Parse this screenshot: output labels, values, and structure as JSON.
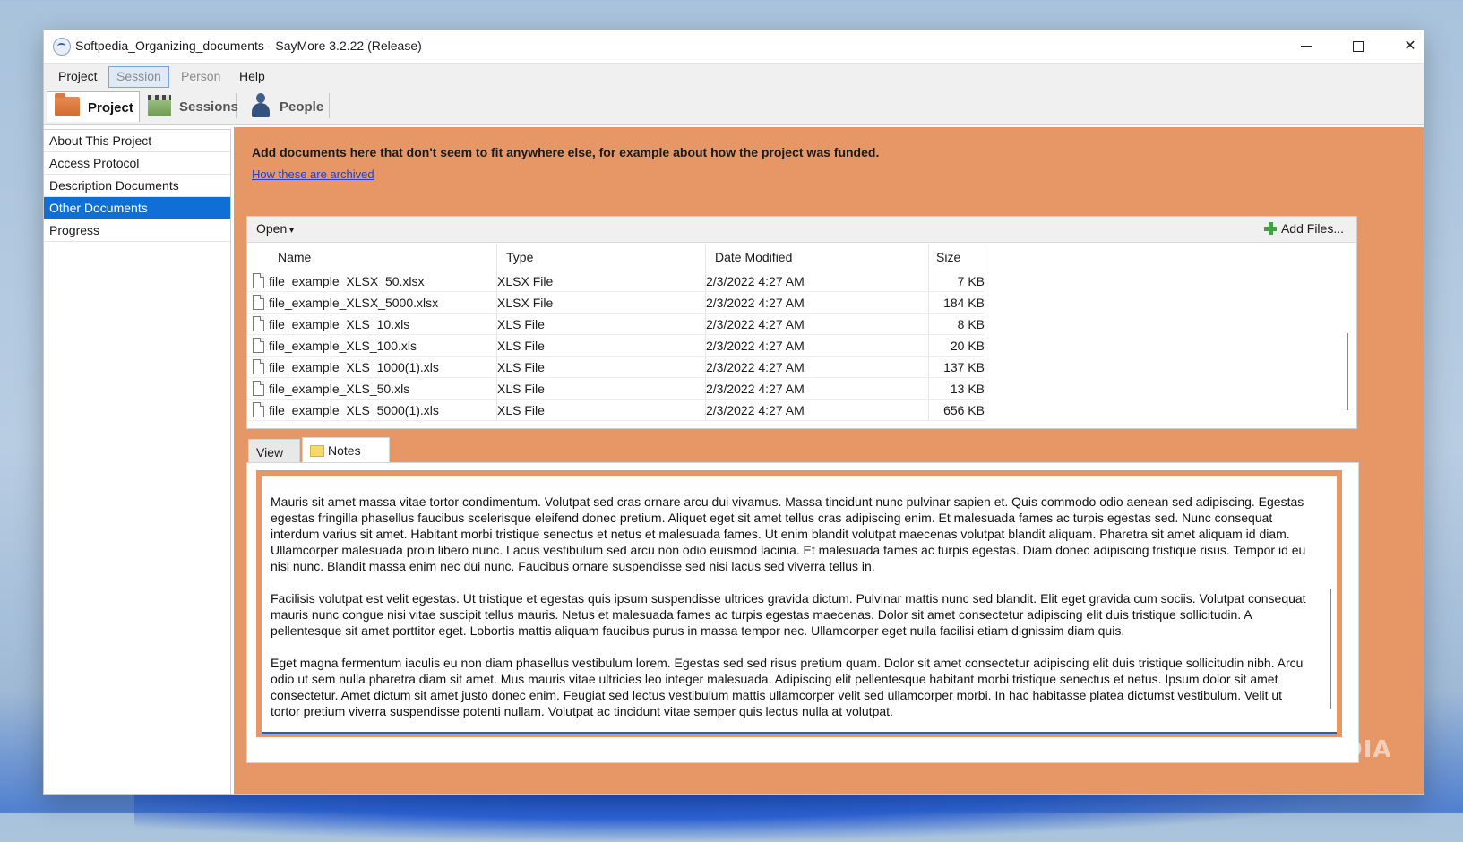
{
  "window": {
    "title": "Softpedia_Organizing_documents - SayMore 3.2.22 (Release)",
    "minimize_glyph": "",
    "maximize_glyph": "",
    "close_glyph": "✕"
  },
  "menu": {
    "items": [
      {
        "label": "Project"
      },
      {
        "label": "Session"
      },
      {
        "label": "Person"
      },
      {
        "label": "Help"
      }
    ]
  },
  "modes": {
    "tabs": [
      {
        "label": "Project",
        "icon": "folder-icon"
      },
      {
        "label": "Sessions",
        "icon": "clapperboard-icon"
      },
      {
        "label": "People",
        "icon": "person-icon"
      }
    ]
  },
  "sidebar": {
    "items": [
      {
        "label": "About This Project"
      },
      {
        "label": "Access Protocol"
      },
      {
        "label": "Description Documents"
      },
      {
        "label": "Other Documents"
      },
      {
        "label": "Progress"
      }
    ],
    "selected": "Other Documents"
  },
  "main": {
    "instructions": "Add documents here that don't seem to fit anywhere else, for example about how the project was funded.",
    "archive_link": "How these are archived",
    "accent_color": "#e79766"
  },
  "files": {
    "open_label": "Open",
    "add_files_label": "Add Files...",
    "columns": [
      "Name",
      "Type",
      "Date Modified",
      "Size"
    ],
    "rows": [
      {
        "name": "file_example_XLSX_50.xlsx",
        "type": "XLSX File",
        "date": "2/3/2022 4:27 AM",
        "size": "7 KB"
      },
      {
        "name": "file_example_XLSX_5000.xlsx",
        "type": "XLSX File",
        "date": "2/3/2022 4:27 AM",
        "size": "184 KB"
      },
      {
        "name": "file_example_XLS_10.xls",
        "type": "XLS File",
        "date": "2/3/2022 4:27 AM",
        "size": "8 KB"
      },
      {
        "name": "file_example_XLS_100.xls",
        "type": "XLS File",
        "date": "2/3/2022 4:27 AM",
        "size": "20 KB"
      },
      {
        "name": "file_example_XLS_1000(1).xls",
        "type": "XLS File",
        "date": "2/3/2022 4:27 AM",
        "size": "137 KB"
      },
      {
        "name": "file_example_XLS_50.xls",
        "type": "XLS File",
        "date": "2/3/2022 4:27 AM",
        "size": "13 KB"
      },
      {
        "name": "file_example_XLS_5000(1).xls",
        "type": "XLS File",
        "date": "2/3/2022 4:27 AM",
        "size": "656 KB"
      }
    ]
  },
  "detail_tabs": {
    "view_label": "View",
    "notes_label": "Notes"
  },
  "notes": {
    "paragraphs": [
      "Mauris sit amet massa vitae tortor condimentum. Volutpat sed cras ornare arcu dui vivamus. Massa tincidunt nunc pulvinar sapien et. Quis commodo odio aenean sed adipiscing. Egestas egestas fringilla phasellus faucibus scelerisque eleifend donec pretium. Aliquet eget sit amet tellus cras adipiscing enim. Et malesuada fames ac turpis egestas sed. Nunc consequat interdum varius sit amet. Habitant morbi tristique senectus et netus et malesuada fames. Ut enim blandit volutpat maecenas volutpat blandit aliquam. Pharetra sit amet aliquam id diam. Ullamcorper malesuada proin libero nunc. Lacus vestibulum sed arcu non odio euismod lacinia. Et malesuada fames ac turpis egestas. Diam donec adipiscing tristique risus. Tempor id eu nisl nunc. Blandit massa enim nec dui nunc. Faucibus ornare suspendisse sed nisi lacus sed viverra tellus in.",
      "Facilisis volutpat est velit egestas. Ut tristique et egestas quis ipsum suspendisse ultrices gravida dictum. Pulvinar mattis nunc sed blandit. Elit eget gravida cum sociis. Volutpat consequat mauris nunc congue nisi vitae suscipit tellus mauris. Netus et malesuada fames ac turpis egestas maecenas. Dolor sit amet consectetur adipiscing elit duis tristique sollicitudin. A pellentesque sit amet porttitor eget. Lobortis mattis aliquam faucibus purus in massa tempor nec. Ullamcorper eget nulla facilisi etiam dignissim diam quis.",
      "Eget magna fermentum iaculis eu non diam phasellus vestibulum lorem. Egestas sed sed risus pretium quam. Dolor sit amet consectetur adipiscing elit duis tristique sollicitudin nibh. Arcu odio ut sem nulla pharetra diam sit amet. Mus mauris vitae ultricies leo integer malesuada. Adipiscing elit pellentesque habitant morbi tristique senectus et netus. Ipsum dolor sit amet consectetur. Amet dictum sit amet justo donec enim. Feugiat sed lectus vestibulum mattis ullamcorper velit sed ullamcorper morbi. In hac habitasse platea dictumst vestibulum. Velit ut tortor pretium viverra suspendisse potenti nullam. Volutpat ac tincidunt vitae semper quis lectus nulla at volutpat."
    ]
  },
  "watermark": "SOFTPEDIA"
}
